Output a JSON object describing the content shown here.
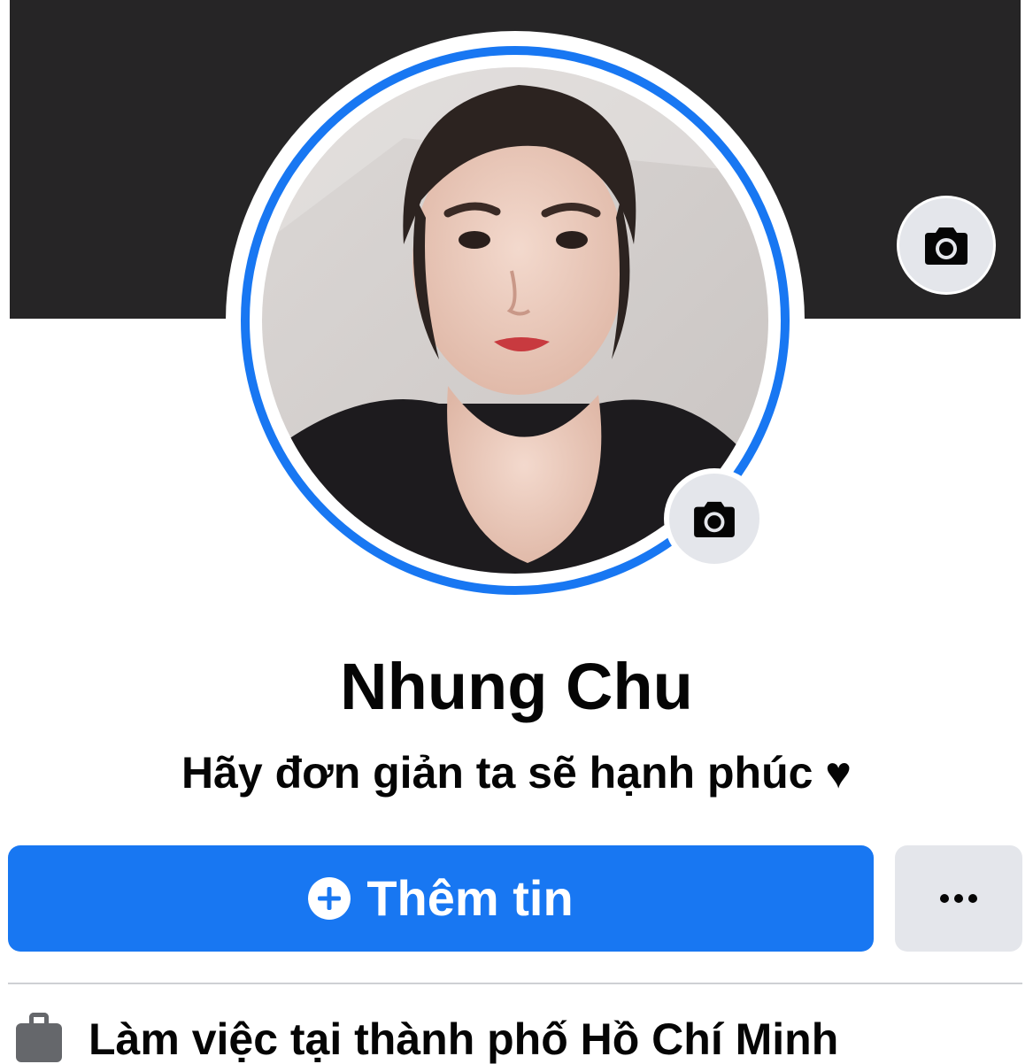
{
  "profile": {
    "name": "Nhung Chu",
    "bio": "Hãy đơn giản ta sẽ hạnh phúc ♥"
  },
  "actions": {
    "add_story_label": "Thêm tin",
    "more_label": "..."
  },
  "intro": {
    "work_text": "Làm việc tại thành phố Hồ Chí Minh"
  },
  "icons": {
    "cover_camera": "camera-icon",
    "avatar_camera": "camera-icon",
    "add": "plus-circle-icon",
    "more": "ellipsis-icon",
    "work": "briefcase-icon"
  },
  "colors": {
    "accent": "#1877f2",
    "cover": "#262526",
    "secondary_button": "#e4e6eb",
    "text": "#050505",
    "divider": "#ced0d4"
  }
}
